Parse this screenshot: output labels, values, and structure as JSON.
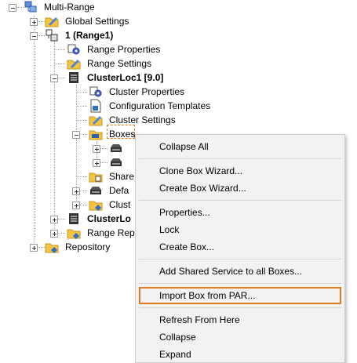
{
  "tree": {
    "root": {
      "label": "Multi-Range",
      "icon": "multi-range-icon"
    },
    "global_settings": {
      "label": "Global Settings",
      "icon": "folder-settings-icon"
    },
    "range1": {
      "label": "1 (Range1)",
      "icon": "range-icon"
    },
    "range_properties": {
      "label": "Range Properties",
      "icon": "properties-gear-icon"
    },
    "range_settings": {
      "label": "Range Settings",
      "icon": "folder-settings-icon"
    },
    "clusterloc1": {
      "label": "ClusterLoc1 [9.0]",
      "icon": "cluster-server-icon"
    },
    "cluster_properties": {
      "label": "Cluster Properties",
      "icon": "properties-gear-icon"
    },
    "configuration_templates": {
      "label": "Configuration Templates",
      "icon": "template-document-icon"
    },
    "cluster_settings": {
      "label": "Cluster Settings",
      "icon": "folder-settings-icon"
    },
    "boxes": {
      "label": "Boxes",
      "icon": "folder-boxes-icon"
    },
    "box_a": {
      "label": "",
      "icon": "box-device-icon"
    },
    "box_b": {
      "label": "",
      "icon": "box-device-icon"
    },
    "shared": {
      "label": "Share",
      "icon": "folder-shared-icon"
    },
    "default": {
      "label": "Defa",
      "icon": "box-device-icon"
    },
    "cluster_item": {
      "label": "Clust",
      "icon": "folder-cluster-icon"
    },
    "clusterloc2": {
      "label": "ClusterLo",
      "icon": "cluster-server-icon"
    },
    "range_repository": {
      "label": "Range Rep",
      "icon": "folder-repository-icon"
    },
    "repository": {
      "label": "Repository",
      "icon": "folder-repository-icon"
    }
  },
  "context_menu": {
    "items": [
      "Collapse All",
      "Clone Box Wizard...",
      "Create Box Wizard...",
      "Properties...",
      "Lock",
      "Create Box...",
      "Add Shared Service to all Boxes...",
      "Import Box from PAR...",
      "Refresh From Here",
      "Collapse",
      "Expand"
    ],
    "highlighted_item": "Import Box from PAR...",
    "highlight_color": "#e07a1f"
  }
}
